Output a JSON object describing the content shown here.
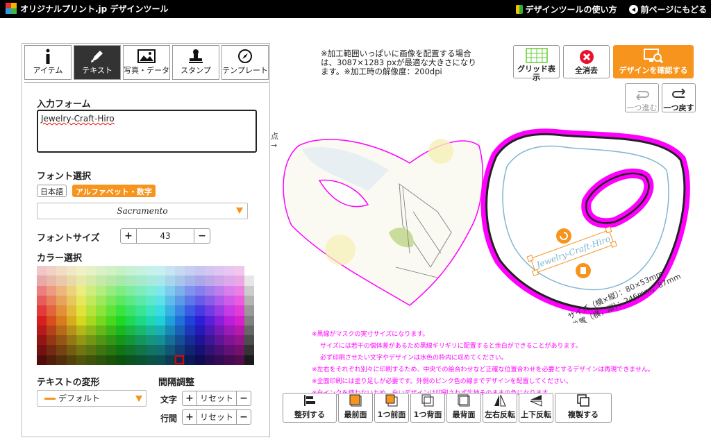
{
  "header": {
    "brand": "オリジナルプリント.jp デザインツール",
    "how_to": "デザインツールの使い方",
    "back": "前ページにもどる"
  },
  "tabs": [
    {
      "label": "アイテム"
    },
    {
      "label": "テキスト"
    },
    {
      "label": "写真・データ"
    },
    {
      "label": "スタンプ"
    },
    {
      "label": "テンプレート"
    }
  ],
  "text_panel": {
    "input_label": "入力フォーム",
    "input_value": "Jewelry-Craft-Hiro",
    "font_label": "フォント選択",
    "font_tab_jp": "日本語",
    "font_tab_alpha": "アルファベット・数字",
    "font_selected": "Sacramento",
    "size_label": "フォントサイズ",
    "size_value": "43",
    "color_label": "カラー選択",
    "transform_label": "テキストの変形",
    "transform_value": "デフォルト",
    "spacing_label": "間隔調整",
    "char_label": "文字",
    "line_label": "行間",
    "reset": "リセット"
  },
  "notice": "※加工範囲いっぱいに画像を配置する場合は、3087×1283 pxが最適な大きさになります。※加工時の解像度：200dpi",
  "toolbar": {
    "grid": "グリッド表示",
    "clear": "全消去",
    "confirm": "デザインを確認する",
    "redo": "一つ進む",
    "undo": "一つ戻す"
  },
  "canvas": {
    "guide_label": "点",
    "size_text": "サイズ（横×縦）：80×53mm",
    "pos_text": "位置（横，縦）：246mm，87mm",
    "design_text": "Jewelry-Craft-Hiro"
  },
  "pink_notes": [
    "※黒線がマスクの実寸サイズになります。",
    "サイズには若干の個体差があるため黒線ギリギリに配置すると余白ができることがあります。",
    "必ず印刷させたい文字やデザインは水色の枠内に収めてください。",
    "※左右をそれぞれ別々に印刷するため、中央での絵合わせなど正確な位置合わせを必要とするデザインは再現できません。",
    "※全面印刷には塗り足しが必要です。外側のピンク色の線までデザインを配置してください。",
    "※白インクを使わないため、白いデザインは印刷されず生地そのままの色になります。"
  ],
  "bottom_buttons": [
    {
      "label": "整列する"
    },
    {
      "label": "最前面"
    },
    {
      "label": "1つ前面"
    },
    {
      "label": "1つ背面"
    },
    {
      "label": "最背面"
    },
    {
      "label": "左右反転"
    },
    {
      "label": "上下反転"
    },
    {
      "label": "複製する"
    }
  ],
  "colors": {
    "accent": "#f7941d",
    "magenta": "#ff00ff",
    "guide": "#7fb7d1"
  }
}
